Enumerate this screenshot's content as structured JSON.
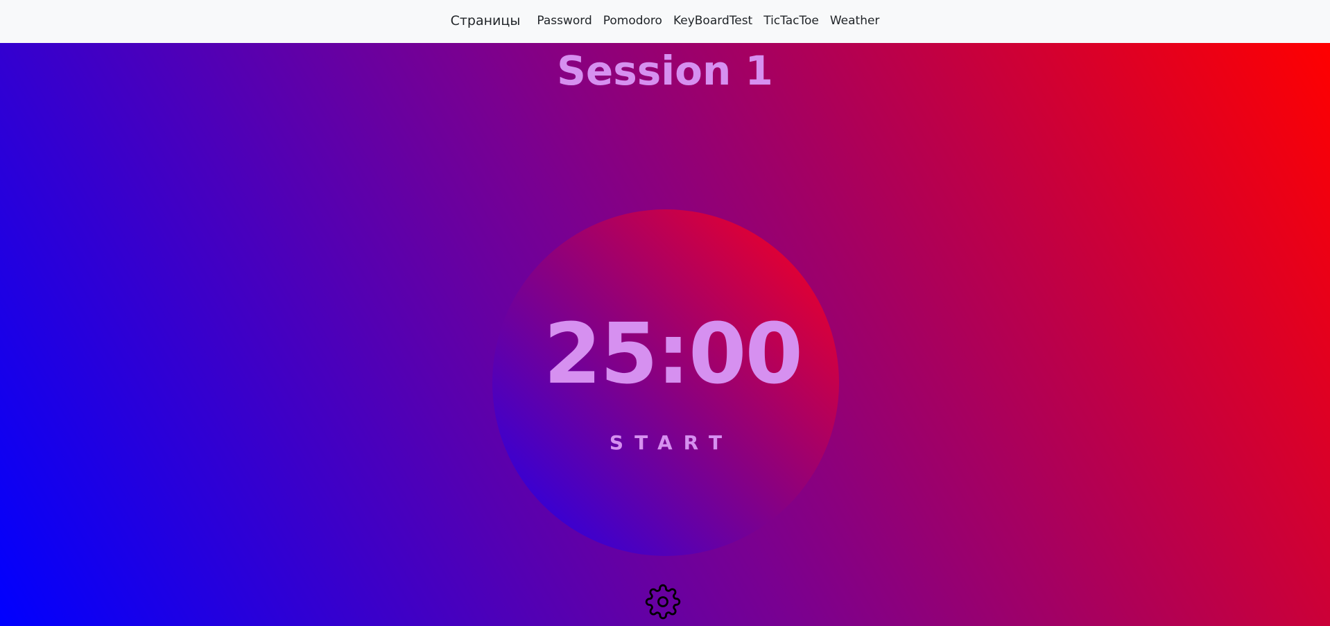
{
  "navbar": {
    "brand": "Страницы",
    "links": [
      {
        "label": "Password"
      },
      {
        "label": "Pomodoro"
      },
      {
        "label": "KeyBoardTest"
      },
      {
        "label": "TicTacToe"
      },
      {
        "label": "Weather"
      }
    ]
  },
  "session": {
    "title": "Session 1"
  },
  "timer": {
    "time": "25:00",
    "start_label": "START"
  },
  "settings": {
    "icon": "gear-icon"
  },
  "colors": {
    "text_accent": "#d690f0",
    "gradient_start": "#0000ff",
    "gradient_end": "#ff0000",
    "navbar_bg": "#f8f9fa"
  }
}
